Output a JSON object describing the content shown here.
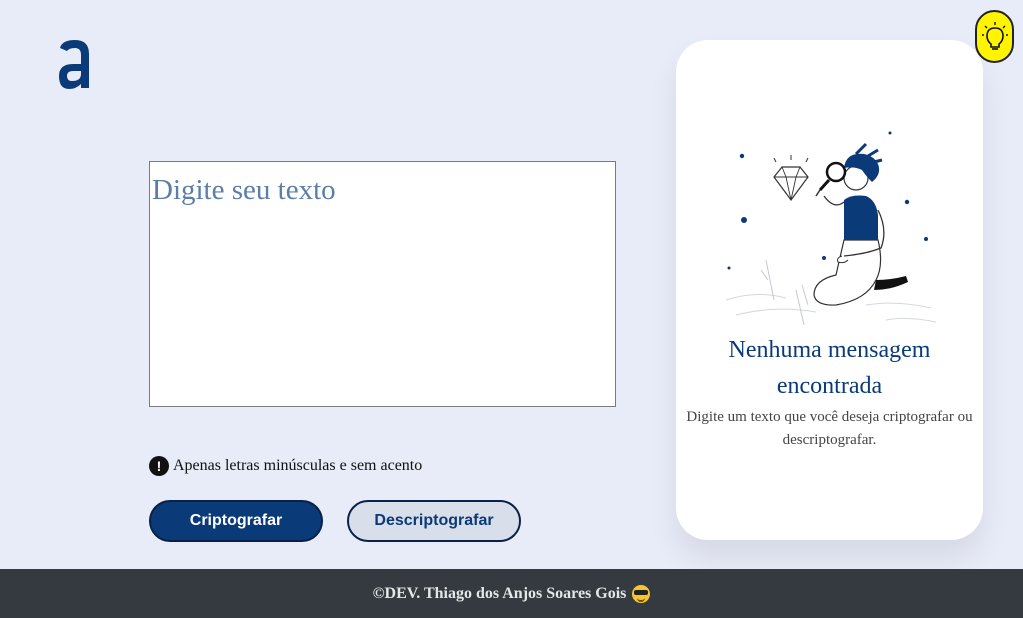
{
  "logo": {
    "icon": "alura-a-logo-icon",
    "color": "#0b3a78"
  },
  "input": {
    "placeholder": "Digite seu texto"
  },
  "warning": {
    "icon": "exclamation-circle-icon",
    "text": "Apenas letras minúsculas e sem acento"
  },
  "buttons": {
    "encrypt_label": "Criptografar",
    "decrypt_label": "Descriptografar"
  },
  "output_card": {
    "illustration": "person-with-magnifying-glass-diamond-illustration",
    "title": "Nenhuma mensagem encontrada",
    "subtitle": "Digite um texto que você deseja criptografar ou descriptografar."
  },
  "theme_toggle": {
    "icon": "lightbulb-icon",
    "color": "#fff400"
  },
  "footer": {
    "text": "©DEV. Thiago dos Anjos Soares Gois",
    "emoji": "sunglasses-emoji-icon"
  },
  "colors": {
    "background": "#e8ebf8",
    "primary": "#0b3a78",
    "footer": "#343a40"
  }
}
